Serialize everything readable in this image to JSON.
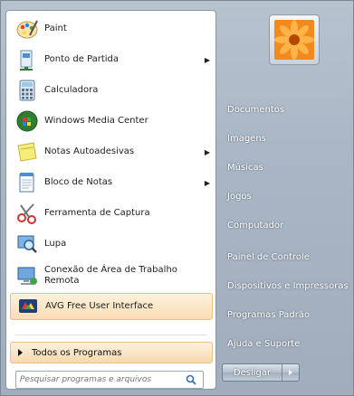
{
  "programs": [
    {
      "label": "Paint",
      "icon": "paint-icon",
      "submenu": false
    },
    {
      "label": "Ponto de Partida",
      "icon": "getting-started-icon",
      "submenu": true
    },
    {
      "label": "Calculadora",
      "icon": "calculator-icon",
      "submenu": false
    },
    {
      "label": "Windows Media Center",
      "icon": "media-center-icon",
      "submenu": false
    },
    {
      "label": "Notas Autoadesivas",
      "icon": "sticky-notes-icon",
      "submenu": true
    },
    {
      "label": "Bloco de Notas",
      "icon": "notepad-icon",
      "submenu": true
    },
    {
      "label": "Ferramenta de Captura",
      "icon": "snipping-tool-icon",
      "submenu": false
    },
    {
      "label": "Lupa",
      "icon": "magnifier-icon",
      "submenu": false
    },
    {
      "label": "Conexão de Área de Trabalho Remota",
      "icon": "remote-desktop-icon",
      "submenu": false
    },
    {
      "label": "AVG Free User Interface",
      "icon": "avg-icon",
      "submenu": false,
      "highlighted": true
    }
  ],
  "all_programs_label": "Todos os Programas",
  "search": {
    "placeholder": "Pesquisar programas e arquivos"
  },
  "right_links": [
    {
      "label": "Documentos"
    },
    {
      "label": "Imagens"
    },
    {
      "label": "Músicas"
    },
    {
      "label": "Jogos"
    },
    {
      "label": "Computador"
    },
    {
      "label": "Painel de Controle"
    },
    {
      "label": "Dispositivos e Impressoras"
    },
    {
      "label": "Programas Padrão"
    },
    {
      "label": "Ajuda e Suporte"
    }
  ],
  "shutdown_label": "Desligar",
  "colors": {
    "highlight": "#f9ddb3",
    "panel": "#a9b6c5",
    "text_light": "#ffffff"
  }
}
